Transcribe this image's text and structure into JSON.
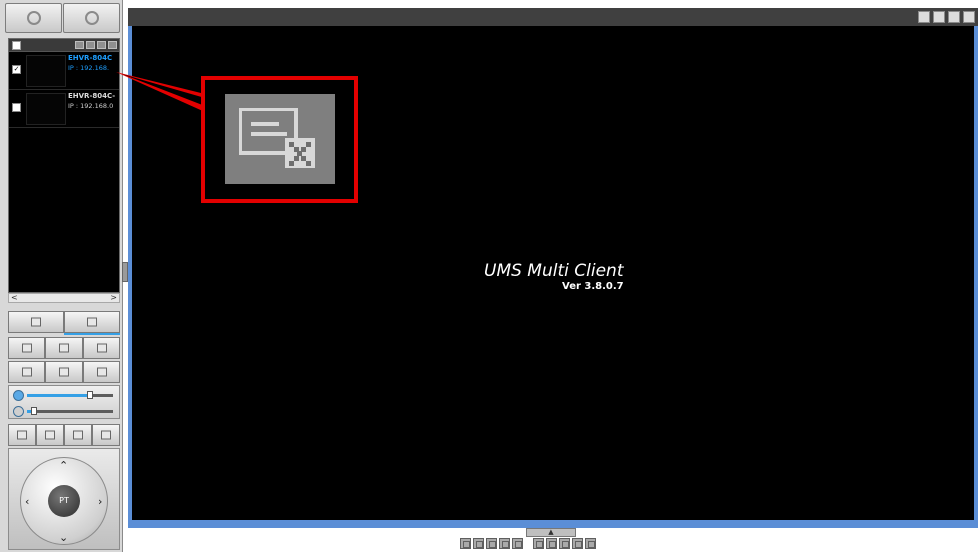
{
  "devices": [
    {
      "name": "EHVR-804C",
      "ip": "IP : 192.168.",
      "selected": true,
      "checked": true
    },
    {
      "name": "EHVR-804C-",
      "ip": "IP : 192.168.0",
      "selected": false,
      "checked": false
    }
  ],
  "ptz": {
    "center_label": "PT"
  },
  "main": {
    "app_title": "UMS Multi Client",
    "version": "Ver 3.8.0.7"
  },
  "sliders": {
    "volume_level": 0.75,
    "mic_level": 0.05
  },
  "colors": {
    "accent": "#5b8ed6",
    "callout": "#e30000",
    "selected_text": "#1e9fff"
  },
  "icons": {
    "top_buttons": [
      "setup-icon",
      "search-icon"
    ],
    "window_controls": [
      "layout-icon",
      "minimize-icon",
      "restore-icon",
      "close-icon"
    ],
    "callout": "remove-device-icon"
  },
  "scroll": {
    "left": "<",
    "right": ">"
  },
  "expand_symbol": "▲"
}
